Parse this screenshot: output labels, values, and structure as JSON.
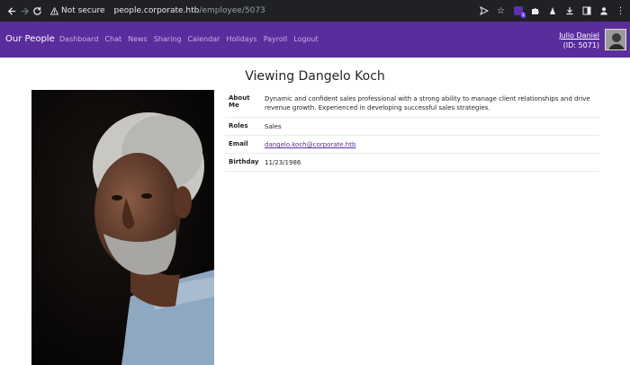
{
  "browser": {
    "security_label": "Not secure",
    "url_host": "people.corporate.htb",
    "url_path": "/employee/5073",
    "extension_badge": "1"
  },
  "navbar": {
    "brand": "Our People",
    "links": [
      "Dashboard",
      "Chat",
      "News",
      "Sharing",
      "Calendar",
      "Holidays",
      "Payroll",
      "Logout"
    ],
    "user_name": "Julio Daniel",
    "user_id": "(ID: 5071)"
  },
  "page": {
    "title": "Viewing Dangelo Koch"
  },
  "details": {
    "about_label": "About Me",
    "about_value": "Dynamic and confident sales professional with a strong ability to manage client relationships and drive revenue growth. Experienced in developing successful sales strategies.",
    "roles_label": "Roles",
    "roles_value": "Sales",
    "email_label": "Email",
    "email_value": "dangelo.koch@corporate.htb",
    "birthday_label": "Birthday",
    "birthday_value": "11/23/1986"
  },
  "colors": {
    "navbar": "#5a2d9c",
    "chrome": "#202124",
    "link": "#5a2d9c"
  }
}
